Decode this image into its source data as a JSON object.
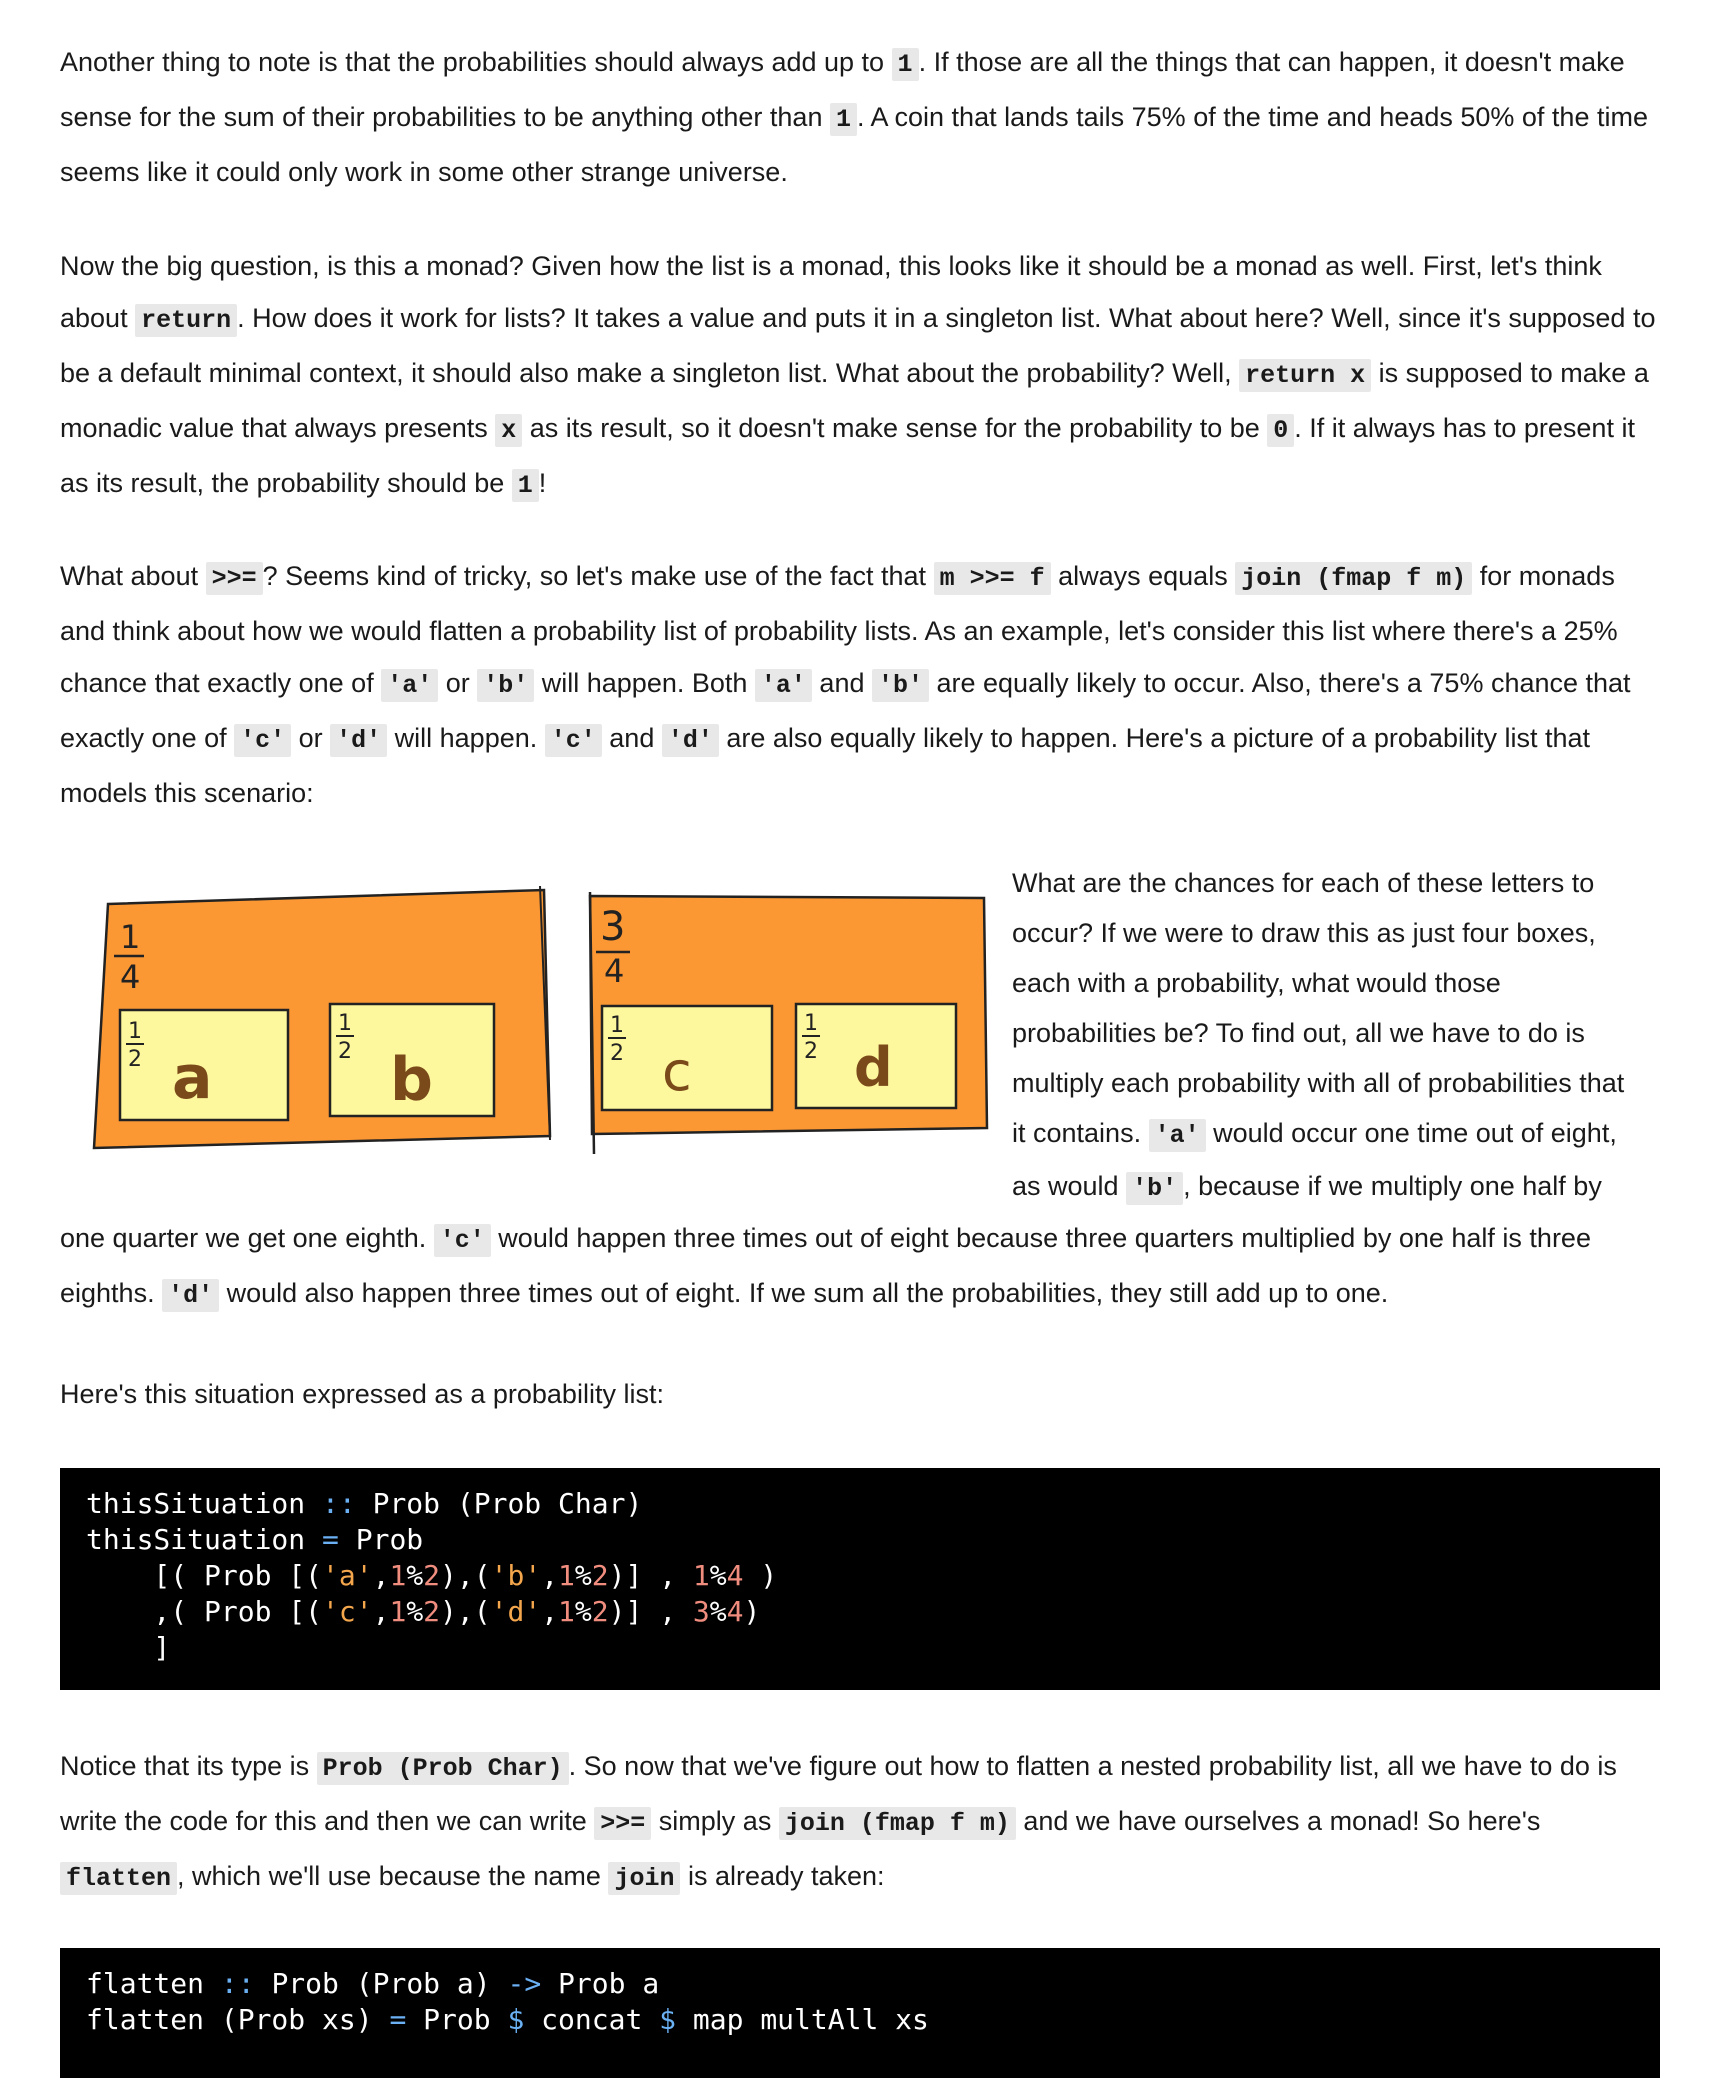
{
  "p1": {
    "t1": "Another thing to note is that the probabilities should always add up to ",
    "c1": "1",
    "t2": ". If those are all the things that can happen, it doesn't make sense for the sum of their probabilities to be anything other than ",
    "c2": "1",
    "t3": ". A coin that lands tails 75% of the time and heads 50% of the time seems like it could only work in some other strange universe."
  },
  "p2": {
    "t1": "Now the big question, is this a monad? Given how the list is a monad, this looks like it should be a monad as well. First, let's think about ",
    "c1": "return",
    "t2": ". How does it work for lists? It takes a value and puts it in a singleton list. What about here? Well, since it's supposed to be a default minimal context, it should also make a singleton list. What about the probability? Well, ",
    "c2": "return x",
    "t3": " is supposed to make a monadic value that always presents ",
    "c3": "x",
    "t4": " as its result, so it doesn't make sense for the probability to be ",
    "c4": "0",
    "t5": ". If it always has to present it as its result, the probability should be ",
    "c5": "1",
    "t6": "!"
  },
  "p3": {
    "t1": "What about ",
    "c1": ">>=",
    "t2": "? Seems kind of tricky, so let's make use of the fact that ",
    "c2": "m >>= f",
    "t3": " always equals ",
    "c3": "join (fmap f m)",
    "t4": " for monads and think about how we would flatten a probability list of probability lists. As an example, let's consider this list where there's a 25% chance that exactly one of ",
    "c4": "'a'",
    "t5": " or ",
    "c5": "'b'",
    "t6": " will happen. Both ",
    "c6": "'a'",
    "t7": " and ",
    "c7": "'b'",
    "t8": " are equally likely to occur. Also, there's a 75% chance that exactly one of ",
    "c8": "'c'",
    "t9": " or ",
    "c9": "'d'",
    "t10": " will happen. ",
    "c10": "'c'",
    "t11": " and ",
    "c11": "'d'",
    "t12": " are also equally likely to happen. Here's a picture of a probability list that models this scenario:"
  },
  "figure": {
    "outer_left": {
      "num": "1",
      "den": "4"
    },
    "outer_right": {
      "num": "3",
      "den": "4"
    },
    "inner": [
      {
        "num": "1",
        "den": "2",
        "letter": "a"
      },
      {
        "num": "1",
        "den": "2",
        "letter": "b"
      },
      {
        "num": "1",
        "den": "2",
        "letter": "c"
      },
      {
        "num": "1",
        "den": "2",
        "letter": "d"
      }
    ],
    "colors": {
      "outer_fill": "#fb9834",
      "inner_fill": "#fdf79d",
      "stroke": "#222222",
      "letter": "#7a4a1a"
    }
  },
  "p4": {
    "l1": "What are the chances for each of these letters to",
    "l2": "occur? If we were to draw this as just four boxes,",
    "l3": "each with a probability, what would those",
    "l4": "probabilities be? To find out, all we have to do is",
    "l5": "multiply each probability with all of probabilities that",
    "l6a": "it contains. ",
    "l6c": "'a'",
    "l6b": " would occur one time out of eight,",
    "l7a": "as would ",
    "l7c": "'b'",
    "l7b": ", because if we multiply one half by",
    "l8a": "one quarter we get one eighth. ",
    "l8c": "'c'",
    "l8b": " would happen three times out of eight because three quarters multiplied by one half is three",
    "l9c0": "eighths. ",
    "l9c": "'d'",
    "l9b": " would also happen three times out of eight. If we sum all the probabilities, they still add up to one."
  },
  "p5": {
    "text": "Here's this situation expressed as a probability list:"
  },
  "code1": {
    "l1": [
      "thisSituation",
      " :: ",
      "Prob (Prob Char)"
    ],
    "l2": [
      "thisSituation",
      " = ",
      "Prob"
    ],
    "l3": [
      "    [( Prob [(",
      "'a'",
      ",",
      "1",
      "%",
      "2",
      "),(",
      "'b'",
      ",",
      "1",
      "%",
      "2",
      ")] , ",
      "1",
      "%",
      "4",
      " )"
    ],
    "l4": [
      "    ,( Prob [(",
      "'c'",
      ",",
      "1",
      "%",
      "2",
      "),(",
      "'d'",
      ",",
      "1",
      "%",
      "2",
      ")] , ",
      "3",
      "%",
      "4",
      ")"
    ],
    "l5": [
      "    ]"
    ]
  },
  "p6": {
    "t1": "Notice that its type is ",
    "c1": "Prob (Prob Char)",
    "t2": ". So now that we've figure out how to flatten a nested probability list, all we have to do is write the code for this and then we can write ",
    "c2": ">>=",
    "t3": " simply as ",
    "c3": "join (fmap f m)",
    "t4": " and we have ourselves a monad! So here's ",
    "c4": "flatten",
    "t5": ", which we'll use because the name ",
    "c5": "join",
    "t6": " is already taken:"
  },
  "code2": {
    "l1": [
      "flatten",
      " :: ",
      "Prob (Prob a) ",
      "->",
      " Prob a"
    ],
    "l2": [
      "flatten (Prob xs) ",
      "=",
      " Prob ",
      "$",
      " concat ",
      "$",
      " map multAll xs"
    ]
  }
}
